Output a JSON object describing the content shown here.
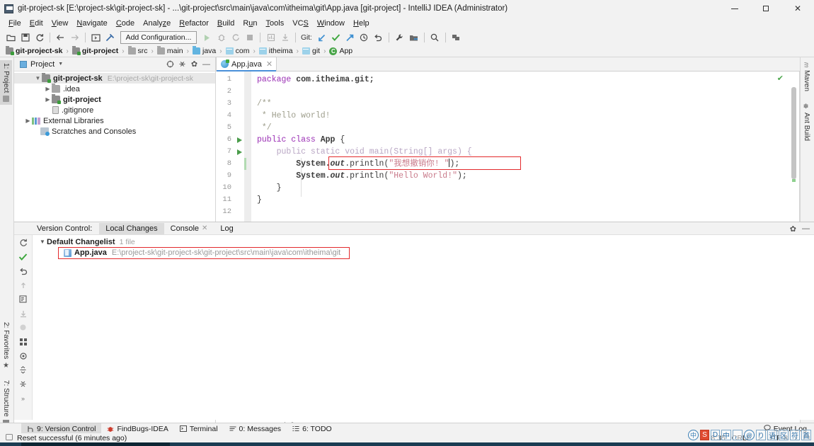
{
  "window": {
    "title": "git-project-sk [E:\\project-sk\\git-project-sk] - ...\\git-project\\src\\main\\java\\com\\itheima\\git\\App.java [git-project] - IntelliJ IDEA (Administrator)",
    "app_icon": "intellij-idea-icon",
    "minimize_label": "—",
    "maximize_label": "□",
    "close_label": "✕"
  },
  "menu": {
    "items": [
      {
        "label": "File"
      },
      {
        "label": "Edit"
      },
      {
        "label": "View"
      },
      {
        "label": "Navigate"
      },
      {
        "label": "Code"
      },
      {
        "label": "Analyze"
      },
      {
        "label": "Refactor"
      },
      {
        "label": "Build"
      },
      {
        "label": "Run"
      },
      {
        "label": "Tools"
      },
      {
        "label": "VCS"
      },
      {
        "label": "Window"
      },
      {
        "label": "Help"
      }
    ]
  },
  "toolbar": {
    "run_config_label": "Add Configuration...",
    "git_label": "Git:",
    "buttons": [
      {
        "name": "open-project-icon",
        "tip": "Open"
      },
      {
        "name": "save-all-icon",
        "tip": "Save All"
      },
      {
        "name": "sync-icon",
        "tip": "Synchronize"
      },
      {
        "name": "back-arrow-icon",
        "tip": "Back"
      },
      {
        "name": "forward-arrow-icon",
        "tip": "Forward"
      },
      {
        "name": "toggle-terminal-icon",
        "tip": "Terminal"
      },
      {
        "name": "build-hammer-icon",
        "tip": "Build"
      },
      {
        "name": "run-icon",
        "tip": "Run"
      },
      {
        "name": "debug-icon",
        "tip": "Debug"
      },
      {
        "name": "run-coverage-icon",
        "tip": "Run with Coverage"
      },
      {
        "name": "stop-icon",
        "tip": "Stop"
      },
      {
        "name": "profiler-icon",
        "tip": "Profiler"
      },
      {
        "name": "download-icon",
        "tip": "Update Project"
      },
      {
        "name": "git-update-icon",
        "tip": "Update Project"
      },
      {
        "name": "git-commit-icon",
        "tip": "Commit"
      },
      {
        "name": "git-push-icon",
        "tip": "Push"
      },
      {
        "name": "history-icon",
        "tip": "History"
      },
      {
        "name": "revert-icon",
        "tip": "Rollback"
      },
      {
        "name": "settings-wrench-icon",
        "tip": "Settings"
      },
      {
        "name": "project-structure-icon",
        "tip": "Project Structure"
      },
      {
        "name": "search-everywhere-icon",
        "tip": "Search Everywhere"
      },
      {
        "name": "database-icon",
        "tip": "Database"
      }
    ]
  },
  "breadcrumbs": [
    {
      "label": "git-project-sk",
      "icon": "module-folder-icon",
      "bold": true
    },
    {
      "label": "git-project",
      "icon": "module-folder-icon",
      "bold": true
    },
    {
      "label": "src",
      "icon": "folder-icon",
      "bold": false
    },
    {
      "label": "main",
      "icon": "folder-icon",
      "bold": false
    },
    {
      "label": "java",
      "icon": "source-folder-icon",
      "bold": false
    },
    {
      "label": "com",
      "icon": "package-icon",
      "bold": false
    },
    {
      "label": "itheima",
      "icon": "package-icon",
      "bold": false
    },
    {
      "label": "git",
      "icon": "package-icon",
      "bold": false
    },
    {
      "label": "App",
      "icon": "java-class-icon",
      "bold": false
    }
  ],
  "left_rail": {
    "tabs": [
      {
        "label": "1: Project",
        "icon": "project-icon",
        "active": true
      },
      {
        "label": "2: Favorites",
        "icon": "star-icon",
        "active": false
      },
      {
        "label": "7: Structure",
        "icon": "structure-icon",
        "active": false
      }
    ]
  },
  "right_rail": {
    "tabs": [
      {
        "label": "Maven",
        "icon": "maven-icon"
      },
      {
        "label": "Ant Build",
        "icon": "ant-icon"
      }
    ]
  },
  "project_panel": {
    "title": "Project",
    "caret": "▼",
    "actions": [
      {
        "name": "locate-icon",
        "glyph": "⊕"
      },
      {
        "name": "collapse-all-icon",
        "glyph": "⇲"
      },
      {
        "name": "settings-gear-icon",
        "glyph": "✿"
      },
      {
        "name": "hide-panel-icon",
        "glyph": "—"
      }
    ],
    "tree": [
      {
        "label": "git-project-sk",
        "path": "E:\\project-sk\\git-project-sk",
        "arrow": "v",
        "indent": 0,
        "bold": true,
        "icon": "module-folder-icon",
        "selected": true
      },
      {
        "label": ".idea",
        "path": "",
        "arrow": ">",
        "indent": 1,
        "bold": false,
        "icon": "folder-icon",
        "selected": false
      },
      {
        "label": "git-project",
        "path": "",
        "arrow": ">",
        "indent": 1,
        "bold": true,
        "icon": "module-folder-icon",
        "selected": false
      },
      {
        "label": ".gitignore",
        "path": "",
        "arrow": "",
        "indent": 1,
        "bold": false,
        "icon": "file-icon",
        "selected": false
      },
      {
        "label": "External Libraries",
        "path": "",
        "arrow": ">",
        "indent": 0,
        "bold": false,
        "icon": "libraries-icon",
        "selected": false
      },
      {
        "label": "Scratches and Consoles",
        "path": "",
        "arrow": "",
        "indent": 0,
        "bold": false,
        "icon": "scratches-icon",
        "selected": false
      }
    ]
  },
  "editor": {
    "tab": {
      "label": "App.java",
      "icon": "java-file-icon",
      "close": "✕"
    },
    "inspection_status": "✔",
    "lines": [
      {
        "n": 1,
        "run": false,
        "changed": false
      },
      {
        "n": 2,
        "run": false,
        "changed": false
      },
      {
        "n": 3,
        "run": false,
        "changed": false
      },
      {
        "n": 4,
        "run": false,
        "changed": false
      },
      {
        "n": 5,
        "run": false,
        "changed": false
      },
      {
        "n": 6,
        "run": true,
        "changed": false
      },
      {
        "n": 7,
        "run": true,
        "changed": false
      },
      {
        "n": 8,
        "run": false,
        "changed": true
      },
      {
        "n": 9,
        "run": false,
        "changed": false
      },
      {
        "n": 10,
        "run": false,
        "changed": false
      },
      {
        "n": 11,
        "run": false,
        "changed": false
      },
      {
        "n": 12,
        "run": false,
        "changed": false
      }
    ],
    "code": {
      "l1_kw": "package",
      "l1_pkg": "com.itheima.git;",
      "l3": "/**",
      "l4": " * Hello world!",
      "l5": " */",
      "l6_kw": "public class",
      "l6_name": "App",
      "l6_brace": "{",
      "l7": "public static void main(String[] args) {",
      "l8_sys": "System.",
      "l8_out": "out",
      "l8_call": ".println(",
      "l8_str": "\"我想撤销你! \"",
      "l8_end": ");",
      "l9_sys": "System.",
      "l9_out": "out",
      "l9_call": ".println(",
      "l9_str": "\"Hello World!\"",
      "l9_end": ");",
      "l10": "}",
      "l11": "}"
    },
    "breadcrumb_bottom": [
      {
        "label": "App"
      },
      {
        "label": "main()"
      }
    ]
  },
  "version_control": {
    "panel_label": "Version Control:",
    "tabs": [
      {
        "label": "Local Changes",
        "active": true,
        "closable": false
      },
      {
        "label": "Console",
        "active": false,
        "closable": true
      },
      {
        "label": "Log",
        "active": false,
        "closable": false
      }
    ],
    "header_actions": [
      {
        "name": "settings-gear-icon",
        "glyph": "✿"
      },
      {
        "name": "hide-panel-icon",
        "glyph": "—"
      }
    ],
    "rail_actions": [
      {
        "name": "refresh-icon",
        "glyph": "⟳"
      },
      {
        "name": "commit-checkmark-icon",
        "glyph": "✔"
      },
      {
        "name": "rollback-icon",
        "glyph": "↺"
      },
      {
        "name": "shelve-icon",
        "glyph": "⤒"
      },
      {
        "name": "diff-icon",
        "glyph": "▤"
      },
      {
        "name": "get-icon",
        "glyph": "⤓"
      },
      {
        "name": "delete-icon",
        "glyph": "⬤"
      },
      {
        "name": "move-to-changelist-icon",
        "glyph": "⛶"
      },
      {
        "name": "preview-diff-icon",
        "glyph": "◎"
      },
      {
        "name": "expand-all-icon",
        "glyph": "⇱"
      },
      {
        "name": "collapse-all-icon",
        "glyph": "⇲"
      },
      {
        "name": "more-icon",
        "glyph": "»"
      }
    ],
    "changelist": {
      "arrow": "v",
      "name": "Default Changelist",
      "count": "1 file",
      "files": [
        {
          "name": "App.java",
          "path": "E:\\project-sk\\git-project-sk\\git-project\\src\\main\\java\\com\\itheima\\git",
          "icon": "java-file-icon"
        }
      ]
    }
  },
  "tool_windows": {
    "items": [
      {
        "label": "9: Version Control",
        "icon": "branch-icon",
        "active": true
      },
      {
        "label": "FindBugs-IDEA",
        "icon": "bug-icon",
        "active": false
      },
      {
        "label": "Terminal",
        "icon": "terminal-icon",
        "active": false
      },
      {
        "label": "0: Messages",
        "icon": "messages-icon",
        "active": false
      },
      {
        "label": "6: TODO",
        "icon": "todo-icon",
        "active": false
      }
    ],
    "event_log": {
      "label": "Event Log",
      "icon": "balloon-icon"
    }
  },
  "status_bar": {
    "message": "Reset successful (6 minutes ago)",
    "message_icon": "notification-icon",
    "caret_position": "8:35",
    "line_separator": "CRLF",
    "line_separator_caret": "↕",
    "encoding": "UTF-8",
    "encoding_caret": "↕",
    "lock_icon": "unlocked-icon"
  },
  "ime": {
    "items": [
      {
        "label": "中",
        "kind": "round"
      },
      {
        "label": "S",
        "kind": "red"
      },
      {
        "label": "D",
        "kind": "box"
      },
      {
        "label": "中",
        "kind": "box"
      },
      {
        "label": "，",
        "kind": "box"
      },
      {
        "label": "@",
        "kind": "round"
      },
      {
        "label": "り",
        "kind": "box"
      },
      {
        "label": "语",
        "kind": "box"
      },
      {
        "label": "区",
        "kind": "box"
      },
      {
        "label": "符",
        "kind": "box"
      },
      {
        "label": "首",
        "kind": "box"
      }
    ]
  },
  "colors": {
    "accent": "#4a90d9",
    "selection": "#e8e8e8",
    "red_highlight": "#e3292c",
    "changed_green": "#b2dbb2",
    "ok_green": "#4aa64a"
  }
}
